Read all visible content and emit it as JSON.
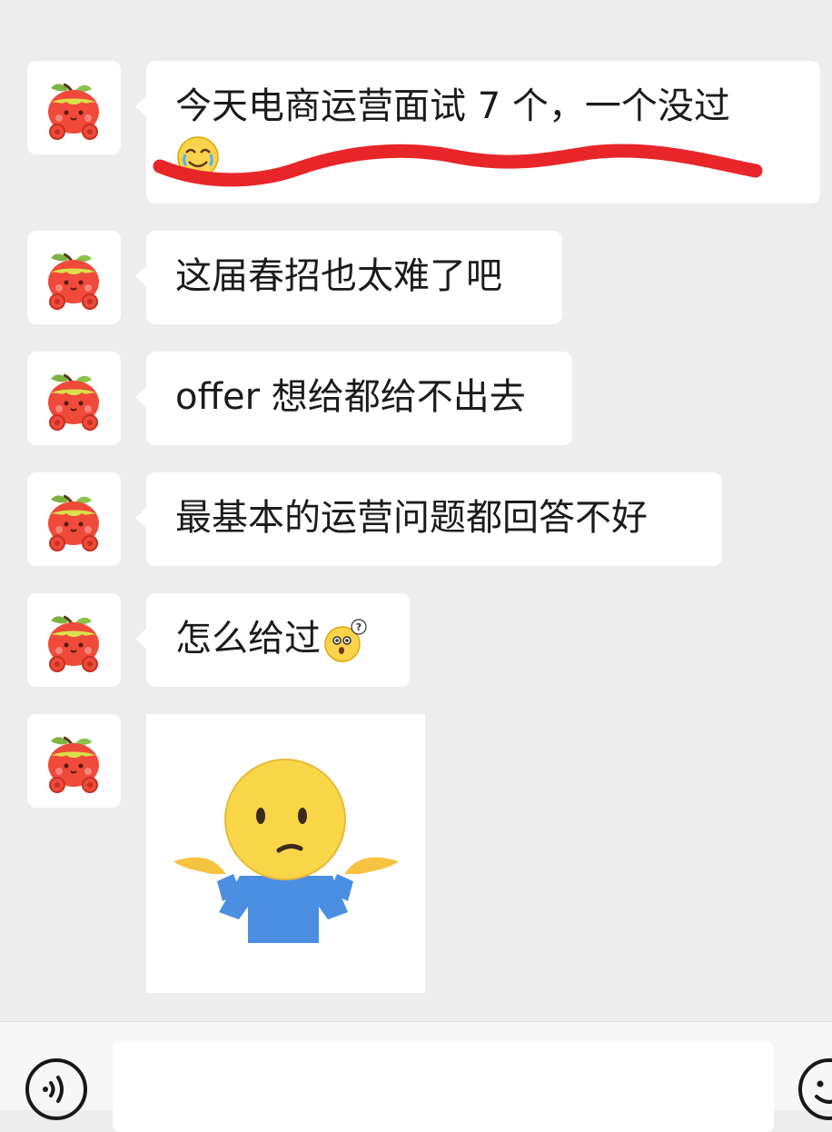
{
  "messages": [
    {
      "sender": "other",
      "type": "text",
      "text": "今天电商运营面试 7 个，一个没过",
      "emoji": "crying-laughing-face"
    },
    {
      "sender": "other",
      "type": "text",
      "text": "这届春招也太难了吧"
    },
    {
      "sender": "other",
      "type": "text",
      "text": "offer 想给都给不出去"
    },
    {
      "sender": "other",
      "type": "text",
      "text": "最基本的运营问题都回答不好"
    },
    {
      "sender": "other",
      "type": "text",
      "text": "怎么给过",
      "emoji": "confused-question-face"
    },
    {
      "sender": "other",
      "type": "sticker",
      "sticker": "shrug-emoji-sticker"
    }
  ],
  "annotation": {
    "type": "red-underline",
    "color": "#e8262a"
  },
  "input_bar": {
    "value": "",
    "voice_icon": "voice-icon",
    "emoji_icon": "emoji-icon"
  },
  "colors": {
    "background": "#ededed",
    "bubble": "#ffffff",
    "text": "#1b1b1b"
  }
}
